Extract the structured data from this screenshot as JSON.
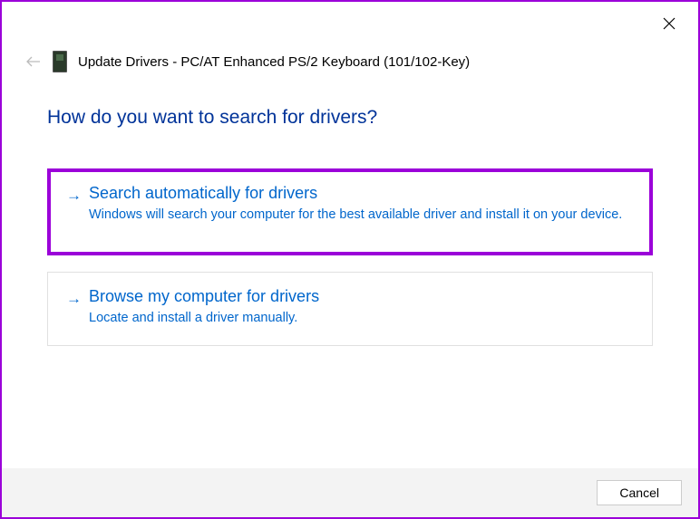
{
  "header": {
    "title": "Update Drivers - PC/AT Enhanced PS/2 Keyboard (101/102-Key)"
  },
  "main": {
    "question": "How do you want to search for drivers?",
    "options": [
      {
        "title": "Search automatically for drivers",
        "description": "Windows will search your computer for the best available driver and install it on your device."
      },
      {
        "title": "Browse my computer for drivers",
        "description": "Locate and install a driver manually."
      }
    ]
  },
  "footer": {
    "cancel_label": "Cancel"
  }
}
